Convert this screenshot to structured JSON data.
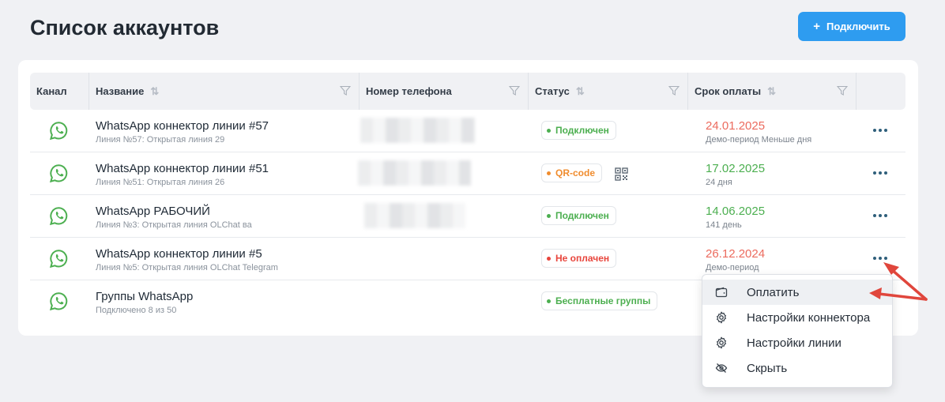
{
  "page": {
    "title": "Список аккаунтов",
    "connect_label": "Подключить"
  },
  "table": {
    "headers": {
      "channel": "Канал",
      "name": "Название",
      "phone": "Номер телефона",
      "status": "Статус",
      "payment_due": "Срок оплаты"
    },
    "rows": [
      {
        "name": "WhatsApp коннектор линии #57",
        "line": "Линия №57: Открытая линия 29",
        "status": "Подключен",
        "status_color": "#4caf50",
        "date": "24.01.2025",
        "date_color": "#ec6b5e",
        "date_sub": "Демо-период Меньше дня"
      },
      {
        "name": "WhatsApp коннектор линии #51",
        "line": "Линия №51: Открытая линия 26",
        "status": "QR-code",
        "status_color": "#f08c2e",
        "date": "17.02.2025",
        "date_color": "#4caf50",
        "date_sub": "24 дня"
      },
      {
        "name": "WhatsApp РАБОЧИЙ",
        "line": "Линия №3: Открытая линия OLChat ва",
        "status": "Подключен",
        "status_color": "#4caf50",
        "date": "14.06.2025",
        "date_color": "#4caf50",
        "date_sub": "141 день"
      },
      {
        "name": "WhatsApp коннектор линии #5",
        "line": "Линия №5: Открытая линия OLChat Telegram",
        "status": "Не оплачен",
        "status_color": "#e8453c",
        "date": "26.12.2024",
        "date_color": "#ec6b5e",
        "date_sub": "Демо-период"
      },
      {
        "name": "Группы WhatsApp",
        "line": "Подключено 8 из 50",
        "status": "Бесплатные группы",
        "status_color": "#4caf50",
        "date": "",
        "date_color": "#4caf50",
        "date_sub": ""
      }
    ]
  },
  "context_menu": {
    "items": [
      {
        "label": "Оплатить",
        "icon": "wallet-icon"
      },
      {
        "label": "Настройки коннектора",
        "icon": "gear-icon"
      },
      {
        "label": "Настройки линии",
        "icon": "gear-icon"
      },
      {
        "label": "Скрыть",
        "icon": "eye-off-icon"
      }
    ]
  },
  "colors": {
    "accent": "#2e9cf0",
    "annotation_arrow": "#e0463c",
    "whatsapp": "#4caf50"
  }
}
